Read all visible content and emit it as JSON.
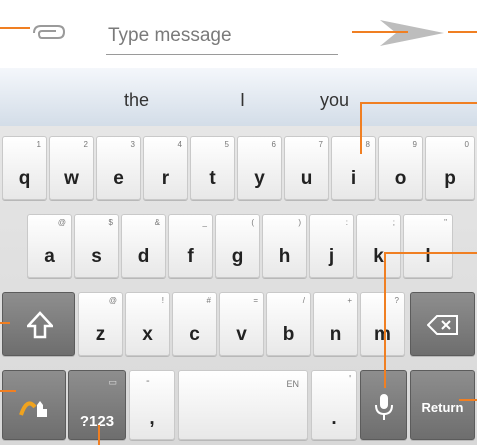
{
  "message_bar": {
    "placeholder": "Type message",
    "attach_icon": "paperclip-icon",
    "send_icon": "send-arrow-icon"
  },
  "suggestions": [
    "the",
    "I",
    "you"
  ],
  "rows": [
    [
      {
        "label": "q",
        "hint": "1"
      },
      {
        "label": "w",
        "hint": "2"
      },
      {
        "label": "e",
        "hint": "3"
      },
      {
        "label": "r",
        "hint": "4"
      },
      {
        "label": "t",
        "hint": "5"
      },
      {
        "label": "y",
        "hint": "6"
      },
      {
        "label": "u",
        "hint": "7"
      },
      {
        "label": "i",
        "hint": "8"
      },
      {
        "label": "o",
        "hint": "9"
      },
      {
        "label": "p",
        "hint": "0"
      }
    ],
    [
      {
        "label": "a",
        "hint": "@"
      },
      {
        "label": "s",
        "hint": "$"
      },
      {
        "label": "d",
        "hint": "&"
      },
      {
        "label": "f",
        "hint": "_"
      },
      {
        "label": "g",
        "hint": "("
      },
      {
        "label": "h",
        "hint": ")"
      },
      {
        "label": "j",
        "hint": ":"
      },
      {
        "label": "k",
        "hint": ";"
      },
      {
        "label": "l",
        "hint": "\""
      }
    ],
    [
      {
        "label": "z",
        "hint": "@"
      },
      {
        "label": "x",
        "hint": "!"
      },
      {
        "label": "c",
        "hint": "#"
      },
      {
        "label": "v",
        "hint": "="
      },
      {
        "label": "b",
        "hint": "/"
      },
      {
        "label": "n",
        "hint": "+"
      },
      {
        "label": "m",
        "hint": "?"
      }
    ]
  ],
  "bottom": {
    "symbols_label": "?123",
    "comma_label": ",",
    "comma_hint": "-",
    "space_hint": "EN",
    "period_label": ".",
    "period_hint": "'",
    "return_label": "Return"
  },
  "icons": {
    "shift": "shift-arrow-icon",
    "backspace": "backspace-icon",
    "mic": "microphone-icon",
    "gesture": "gesture-hand-icon"
  },
  "colors": {
    "callout": "#f07f22"
  }
}
